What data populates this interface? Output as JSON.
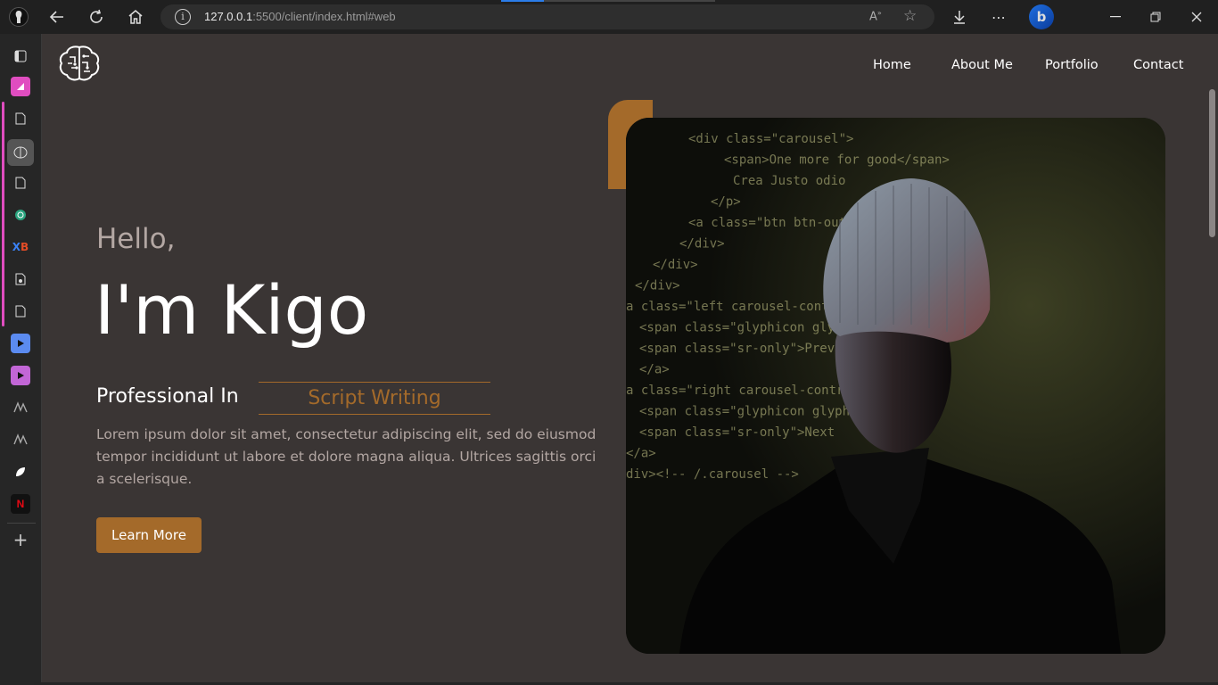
{
  "browser": {
    "url_host": "127.0.0.1",
    "url_rest": ":5500/client/index.html#web"
  },
  "site": {
    "nav": [
      "Home",
      "About Me",
      "Portfolio",
      "Contact"
    ],
    "hero": {
      "greeting": "Hello,",
      "name": "I'm Kigo",
      "professional_label": "Professional In",
      "skill": "Script Writing",
      "description": "Lorem ipsum dolor sit amet, consectetur adipiscing elit, sed do eiusmod tempor incididunt ut labore et dolore magna aliqua. Ultrices sagittis orci a scelerisque.",
      "cta": "Learn More"
    },
    "code_lines": [
      "<div class=\"carousel\">",
      "<span>One more for good</span>",
      "Crea Justo odio",
      "</p>",
      "<a class=\"btn btn-outline\">",
      "</div>",
      "</div>",
      "</div>",
      "a class=\"left carousel-control\"",
      "<span class=\"glyphicon glyphicon\">",
      "<span class=\"sr-only\">Previous",
      "</a>",
      "a class=\"right carousel-control\"",
      "<span class=\"glyphicon glyphicon\">",
      "<span class=\"sr-only\">Next",
      "</a>",
      "div><!-- /.carousel -->"
    ]
  },
  "colors": {
    "accent": "#a46a2a",
    "background": "#3a3534",
    "muted_text": "#b3a7a3"
  }
}
